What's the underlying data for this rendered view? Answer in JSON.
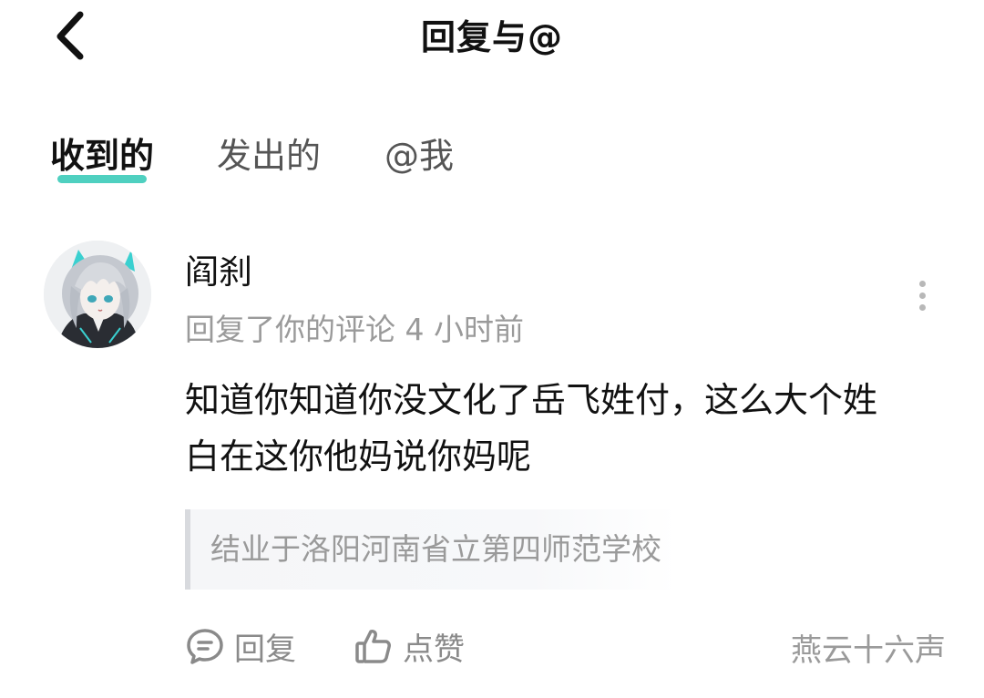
{
  "header": {
    "title": "回复与@",
    "back_icon": "chevron-left-icon"
  },
  "tabs": [
    {
      "label": "收到的",
      "active": true
    },
    {
      "label": "发出的",
      "active": false
    },
    {
      "label": "@我",
      "active": false
    }
  ],
  "accent_color": "#4fd0c0",
  "notification": {
    "username": "阎刹",
    "meta": "回复了你的评论 4 小时前",
    "comment_line1": "知道你知道你没文化了岳飞姓付，这么大个姓",
    "comment_line2": "白在这你他妈说你妈呢",
    "quoted_comment": "结业于洛阳河南省立第四师范学校",
    "actions": {
      "reply_label": "回复",
      "like_label": "点赞"
    },
    "source": "燕云十六声"
  }
}
